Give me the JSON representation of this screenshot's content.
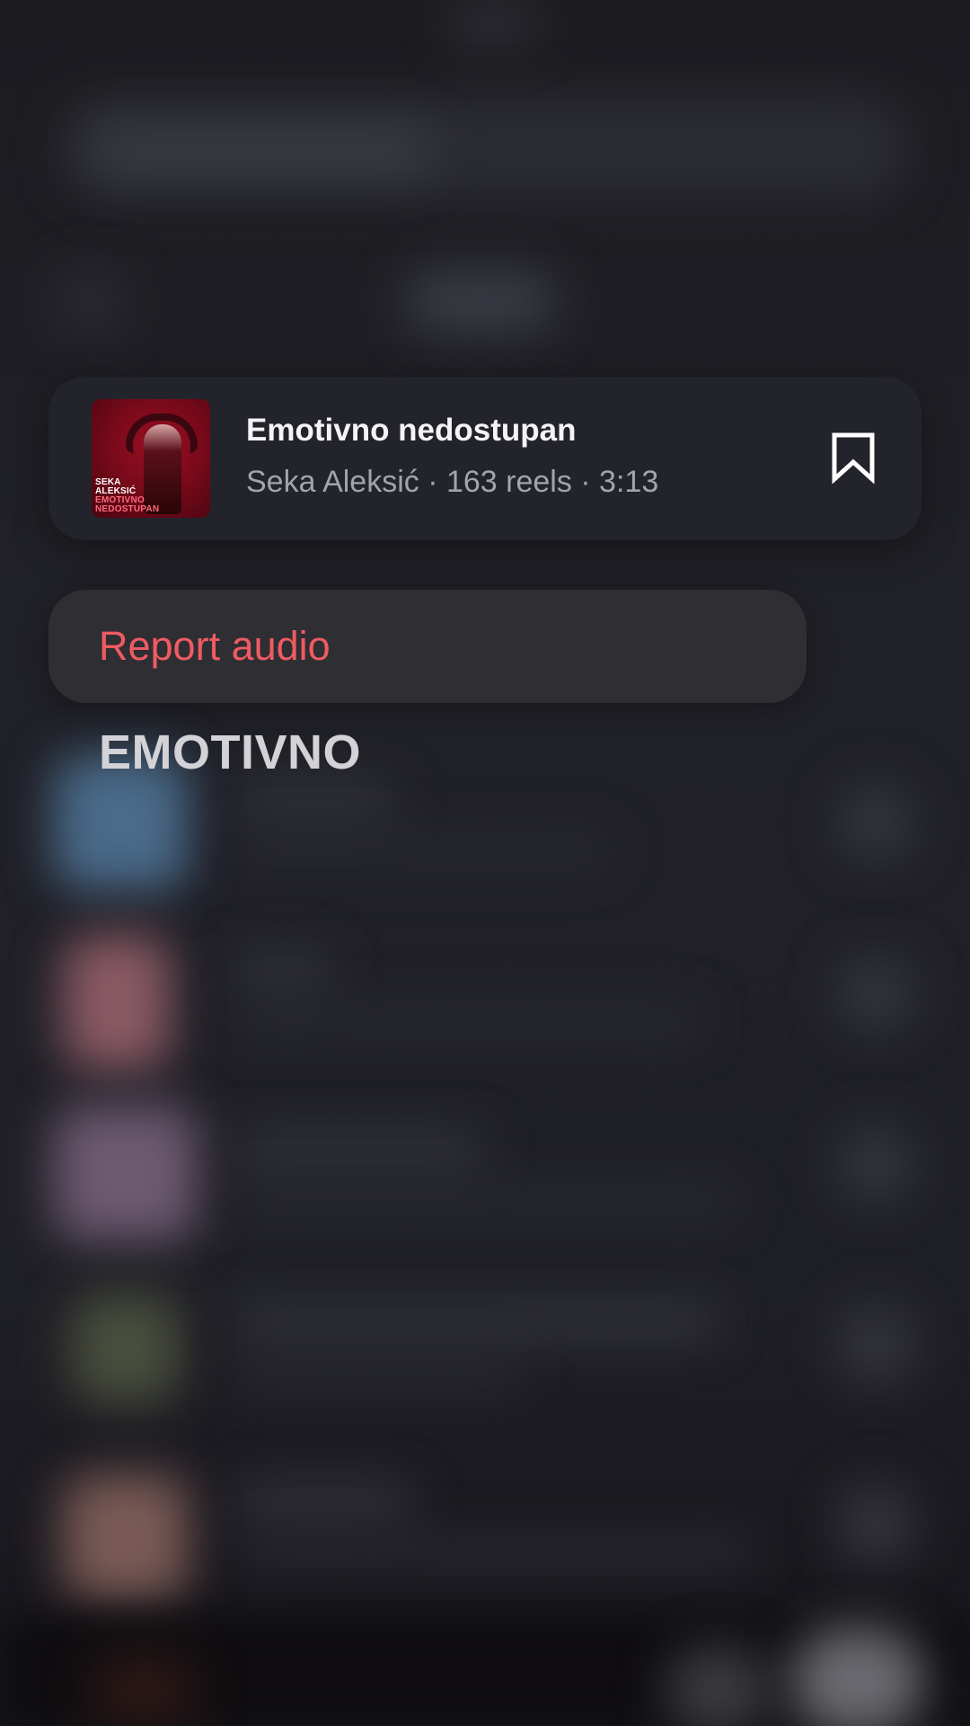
{
  "audio": {
    "title": "Emotivno nedostupan",
    "meta": "Seka Aleksić · 163 reels · 3:13",
    "album_art": {
      "line1": "SEKA",
      "line2": "ALEKSIĆ",
      "line3": "EMOTIVNO",
      "line4": "NEDOSTUPAN"
    }
  },
  "menu": {
    "report_label": "Report audio"
  },
  "section": {
    "heading": "EMOTIVNO"
  },
  "icons": {
    "bookmark": "bookmark-icon"
  },
  "colors": {
    "background": "#1f1f25",
    "card": "#23232b",
    "menu": "#2e2e33",
    "danger": "#ef5b62",
    "title": "#f4f4f6",
    "meta": "#a3a3ad"
  }
}
